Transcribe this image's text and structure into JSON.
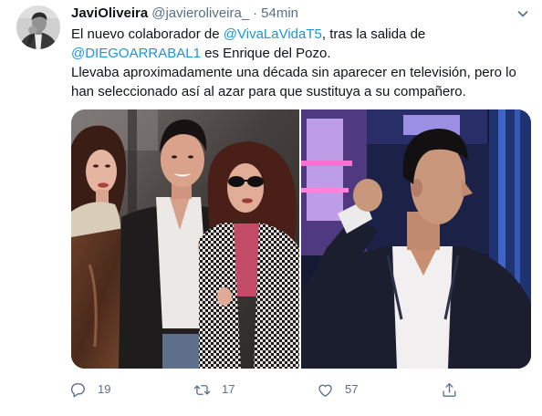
{
  "colors": {
    "text": "#0f1419",
    "secondary": "#5b7083",
    "link": "#1b95e0",
    "background": "#ffffff"
  },
  "tweet": {
    "author": {
      "name": "JaviOliveira",
      "handle": "@javieroliveira_",
      "separator": "·",
      "time": "54min"
    },
    "more_icon": "chevron-down-icon",
    "lines": [
      [
        {
          "text": "El nuevo colaborador de "
        },
        {
          "text": "@VivaLaVidaT5"
        },
        {
          "text": ", tras la salida de"
        }
      ],
      [
        {
          "text": "@DIEGOARRABAL1"
        },
        {
          "text": " es Enrique del Pozo."
        }
      ],
      [
        {
          "text": "Llevaba aproximadamente una década sin aparecer en televisión, pero lo"
        }
      ],
      [
        {
          "text": "han seleccionado así al azar para que sustituya a su compañero."
        }
      ]
    ],
    "actions": {
      "reply": {
        "icon": "reply-icon",
        "count": "19"
      },
      "retweet": {
        "icon": "retweet-icon",
        "count": "17"
      },
      "like": {
        "icon": "heart-icon",
        "count": "57"
      },
      "share": {
        "icon": "share-icon"
      }
    }
  }
}
